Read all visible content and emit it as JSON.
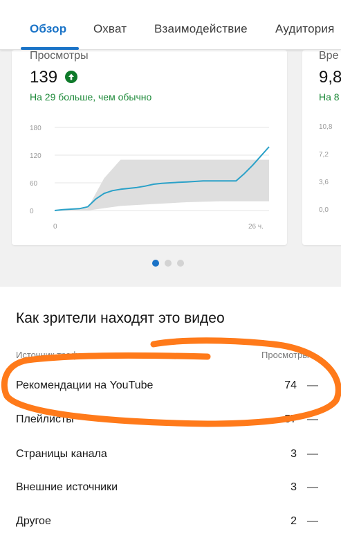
{
  "tabs": {
    "items": [
      {
        "label": "Обзор",
        "active": true
      },
      {
        "label": "Охват",
        "active": false
      },
      {
        "label": "Взаимодействие",
        "active": false
      },
      {
        "label": "Аудитория",
        "active": false
      }
    ]
  },
  "card_views": {
    "title": "Просмотры",
    "value": "139",
    "trend_icon": "arrow-up-circle-icon",
    "note": "На 29 больше, чем обычно",
    "chart_data": {
      "type": "line",
      "x_tick_labels": [
        "0",
        "26 ч."
      ],
      "y_tick_labels": [
        "180",
        "120",
        "60",
        "0"
      ],
      "ylim": [
        0,
        180
      ],
      "xlim": [
        0,
        26
      ],
      "series": [
        {
          "x": [
            0,
            1,
            2,
            3,
            4,
            5,
            6,
            7,
            8,
            9,
            10,
            11,
            12,
            13,
            14,
            15,
            16,
            17,
            18,
            19,
            20,
            21,
            22,
            23,
            24,
            25,
            26
          ],
          "values": [
            0,
            2,
            3,
            4,
            8,
            25,
            37,
            43,
            46,
            48,
            50,
            53,
            57,
            59,
            60,
            61,
            62,
            63,
            64,
            64,
            64,
            64,
            64,
            80,
            98,
            118,
            138
          ],
          "color": "#2aa1c8"
        }
      ],
      "typical_range": {
        "x": [
          0,
          4,
          6,
          8,
          12,
          16,
          20,
          24,
          26
        ],
        "low": [
          0,
          0,
          5,
          10,
          14,
          18,
          20,
          20,
          20
        ],
        "high": [
          0,
          5,
          70,
          110,
          110,
          110,
          110,
          110,
          110
        ],
        "color": "#dedede"
      },
      "grid": true
    }
  },
  "card_watch_time": {
    "title": "Вре",
    "value": "9,8",
    "note": "На 8",
    "y_tick_labels": [
      "10,8",
      "7,2",
      "3,6",
      "0,0"
    ]
  },
  "carousel": {
    "pages": 3,
    "active_page": 1
  },
  "traffic": {
    "title": "Как зрители находят это видео",
    "col_source": "Источник трафика",
    "col_views": "Просмотры",
    "rows": [
      {
        "label": "Рекомендации на YouTube",
        "value": "74",
        "dash": "—"
      },
      {
        "label": "Плейлисты",
        "value": "57",
        "dash": "—"
      },
      {
        "label": "Страницы канала",
        "value": "3",
        "dash": "—"
      },
      {
        "label": "Внешние источники",
        "value": "3",
        "dash": "—"
      },
      {
        "label": "Другое",
        "value": "2",
        "dash": "—"
      }
    ]
  },
  "colors": {
    "accent": "#1a73c7",
    "positive": "#1e8a3a",
    "line": "#2aa1c8",
    "annotation": "#ff7a1a"
  }
}
